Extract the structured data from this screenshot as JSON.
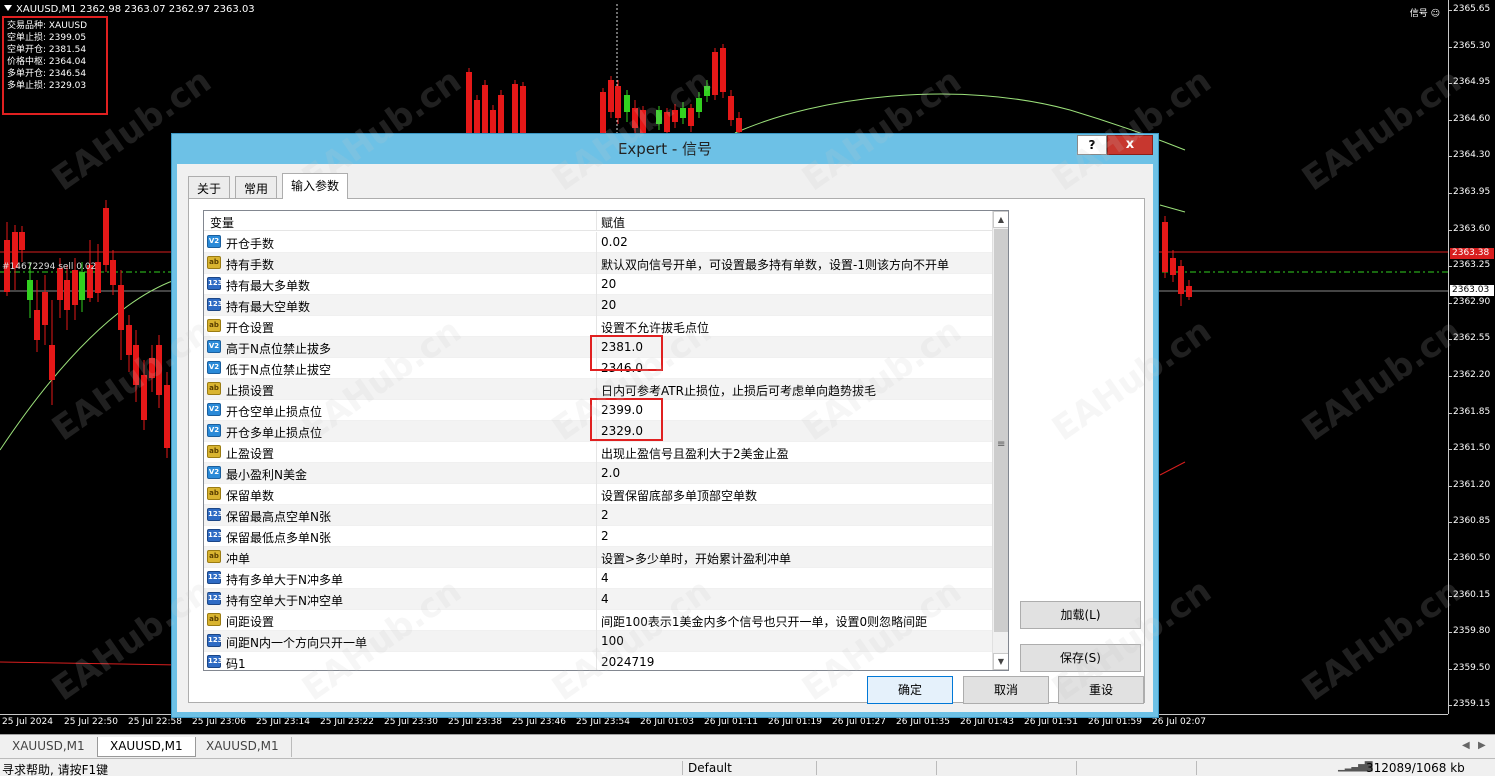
{
  "chart": {
    "header": "XAUUSD,M1  2362.98 2363.07 2362.97 2363.03",
    "ea_badge": "信号",
    "ea_icon": "smiley-icon",
    "order_tag": "#14672294 sell 0.02",
    "info_lines": [
      "交易品种: XAUUSD",
      "空单止损: 2399.05",
      "空单开仓: 2381.54",
      "价格中枢: 2364.04",
      "多单开仓: 2346.54",
      "多单止损: 2329.03"
    ],
    "price_ticks": [
      "2365.65",
      "2365.30",
      "2364.95",
      "2364.60",
      "2364.30",
      "2363.95",
      "2363.60",
      "2363.25",
      "2362.90",
      "2362.55",
      "2362.20",
      "2361.85",
      "2361.50",
      "2361.20",
      "2360.85",
      "2360.50",
      "2360.15",
      "2359.80",
      "2359.50",
      "2359.15"
    ],
    "price_label_red": "2363.38",
    "price_label_current": "2363.03",
    "time_ticks": [
      "25 Jul 2024",
      "25 Jul 22:50",
      "25 Jul 22:58",
      "25 Jul 23:06",
      "25 Jul 23:14",
      "25 Jul 23:22",
      "25 Jul 23:30",
      "25 Jul 23:38",
      "25 Jul 23:46",
      "25 Jul 23:54",
      "26 Jul 01:03",
      "26 Jul 01:11",
      "26 Jul 01:19",
      "26 Jul 01:27",
      "26 Jul 01:35",
      "26 Jul 01:43",
      "26 Jul 01:51",
      "26 Jul 01:59",
      "26 Jul 02:07"
    ],
    "colors": {
      "bull": "#32d11f",
      "bear": "#e51818",
      "ma": "#9be07a",
      "level_red": "#d81e1e",
      "level_green": "#32d11f"
    }
  },
  "watermark": "EAHub.cn",
  "dialog": {
    "title": "Expert - 信号",
    "help_label": "?",
    "close_label": "x",
    "tabs": [
      "关于",
      "常用",
      "输入参数"
    ],
    "columns": {
      "variable": "变量",
      "value": "赋值"
    },
    "params": [
      {
        "icon": "V2",
        "type": "double",
        "name": "开仓手数",
        "value": "0.02"
      },
      {
        "icon": "ab",
        "type": "string",
        "name": "持有手数",
        "value": "默认双向信号开单，可设置最多持有单数，设置-1则该方向不开单"
      },
      {
        "icon": "123",
        "type": "int",
        "name": "持有最大多单数",
        "value": "20"
      },
      {
        "icon": "123",
        "type": "int",
        "name": "持有最大空单数",
        "value": "20"
      },
      {
        "icon": "ab",
        "type": "string",
        "name": "开仓设置",
        "value": "设置不允许拔毛点位"
      },
      {
        "icon": "V2",
        "type": "double",
        "name": "高于N点位禁止拔多",
        "value": "2381.0"
      },
      {
        "icon": "V2",
        "type": "double",
        "name": "低于N点位禁止拔空",
        "value": "2346.0"
      },
      {
        "icon": "ab",
        "type": "string",
        "name": "止损设置",
        "value": "日内可参考ATR止损位，止损后可考虑单向趋势拔毛"
      },
      {
        "icon": "V2",
        "type": "double",
        "name": "开仓空单止损点位",
        "value": "2399.0"
      },
      {
        "icon": "V2",
        "type": "double",
        "name": "开仓多单止损点位",
        "value": "2329.0"
      },
      {
        "icon": "ab",
        "type": "string",
        "name": "止盈设置",
        "value": "出现止盈信号且盈利大于2美金止盈"
      },
      {
        "icon": "V2",
        "type": "double",
        "name": "最小盈利N美金",
        "value": "2.0"
      },
      {
        "icon": "ab",
        "type": "string",
        "name": "保留单数",
        "value": "设置保留底部多单顶部空单数"
      },
      {
        "icon": "123",
        "type": "int",
        "name": "保留最高点空单N张",
        "value": "2"
      },
      {
        "icon": "123",
        "type": "int",
        "name": "保留最低点多单N张",
        "value": "2"
      },
      {
        "icon": "ab",
        "type": "string",
        "name": "冲单",
        "value": "设置>多少单时，开始累计盈利冲单"
      },
      {
        "icon": "123",
        "type": "int",
        "name": "持有多单大于N冲多单",
        "value": "4"
      },
      {
        "icon": "123",
        "type": "int",
        "name": "持有空单大于N冲空单",
        "value": "4"
      },
      {
        "icon": "ab",
        "type": "string",
        "name": "间距设置",
        "value": "间距100表示1美金内多个信号也只开一单，设置0则忽略间距"
      },
      {
        "icon": "123",
        "type": "int",
        "name": "间距N内一个方向只开一单",
        "value": "100"
      },
      {
        "icon": "123",
        "type": "int",
        "name": "码1",
        "value": "2024719"
      }
    ],
    "side_buttons": {
      "load": "加载(L)",
      "save": "保存(S)"
    },
    "footer_buttons": {
      "ok": "确定",
      "cancel": "取消",
      "reset": "重设"
    }
  },
  "bottom_tabs": [
    "XAUUSD,M1",
    "XAUUSD,M1",
    "XAUUSD,M1"
  ],
  "status": {
    "help": "寻求帮助, 请按F1键",
    "profile": "Default",
    "traffic": "312089/1068 kb"
  }
}
